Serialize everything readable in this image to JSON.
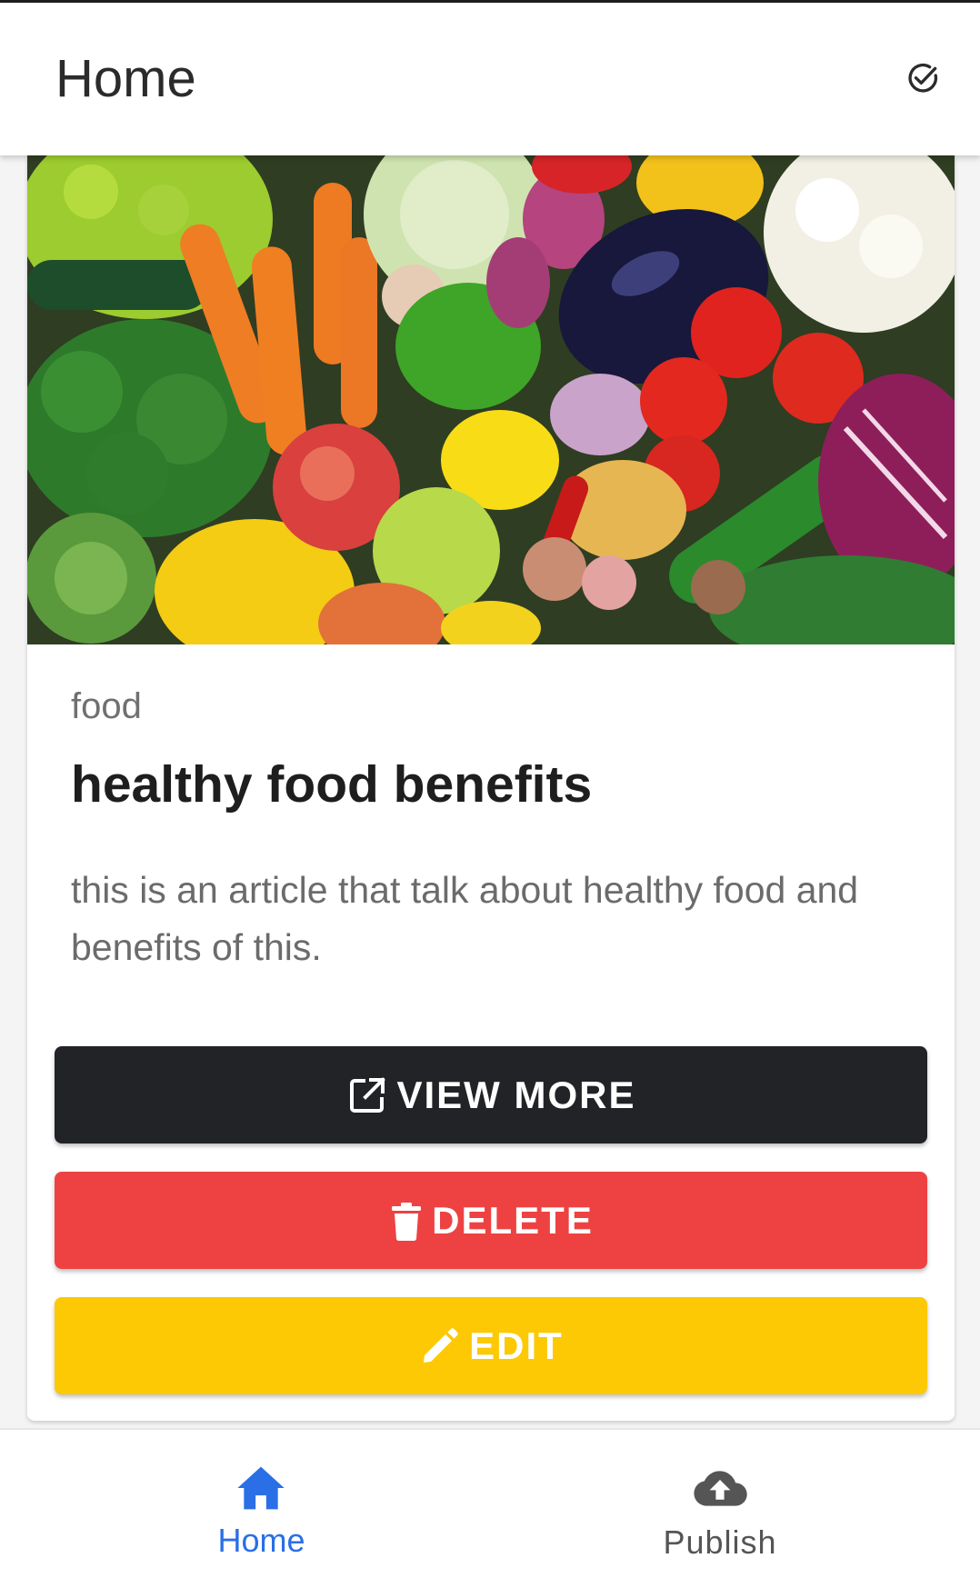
{
  "app_bar": {
    "title": "Home",
    "action_icon": "check-circle-icon"
  },
  "card": {
    "image_alt": "assorted fresh vegetables",
    "category": "food",
    "title": "healthy food benefits",
    "description": "this is an article that talk about healthy food and benefits of this.",
    "buttons": {
      "view_more": {
        "label": "VIEW MORE",
        "icon": "open-in-new-icon",
        "color": "#222326"
      },
      "delete": {
        "label": "DELETE",
        "icon": "trash-icon",
        "color": "#ee4242"
      },
      "edit": {
        "label": "EDIT",
        "icon": "pencil-icon",
        "color": "#fcc904"
      }
    }
  },
  "bottom_nav": {
    "items": [
      {
        "label": "Home",
        "icon": "home-icon",
        "active": true,
        "color": "#2a6fe6"
      },
      {
        "label": "Publish",
        "icon": "cloud-upload-icon",
        "active": false,
        "color": "#555555"
      }
    ]
  }
}
